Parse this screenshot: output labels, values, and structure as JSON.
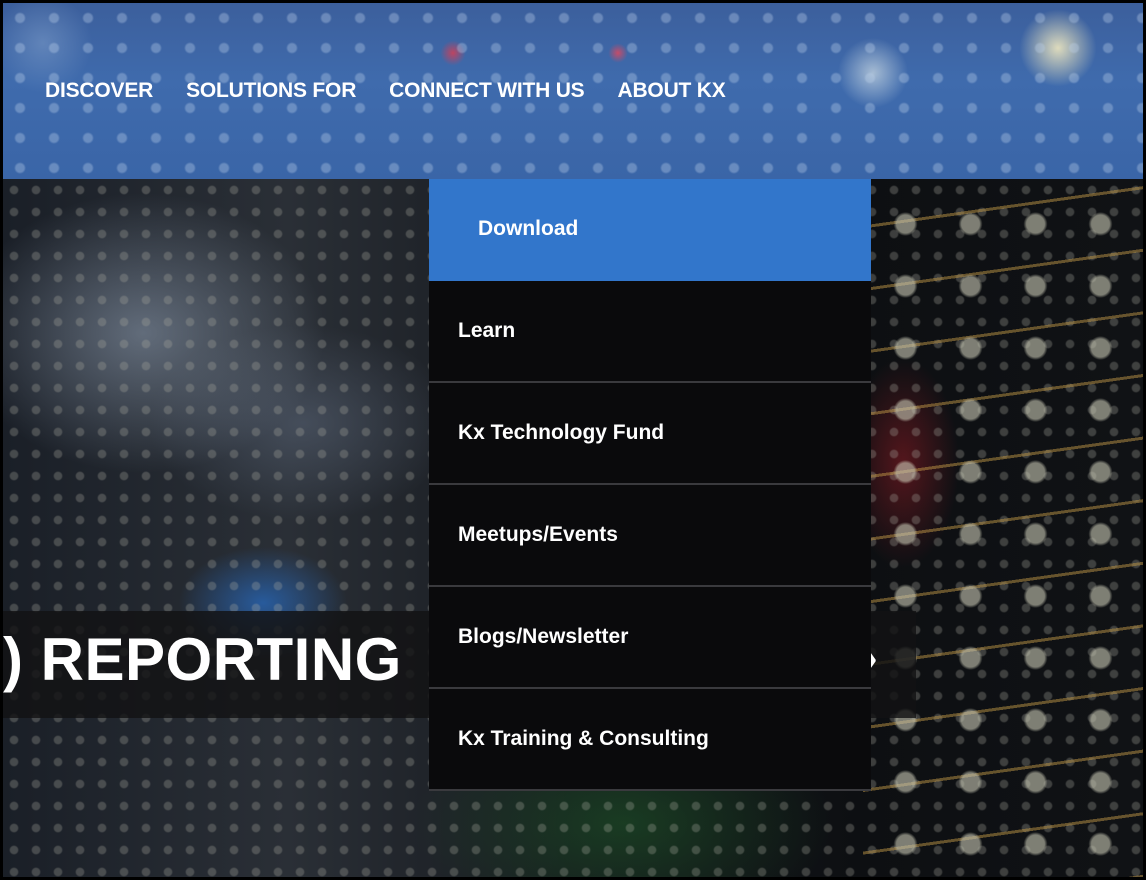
{
  "nav": {
    "items": [
      {
        "label": "DISCOVER"
      },
      {
        "label": "SOLUTIONS FOR"
      },
      {
        "label": "CONNECT WITH US"
      },
      {
        "label": "ABOUT KX"
      }
    ]
  },
  "dropdown": {
    "items": [
      {
        "label": "Download",
        "active": true
      },
      {
        "label": "Learn"
      },
      {
        "label": "Kx Technology Fund"
      },
      {
        "label": "Meetups/Events"
      },
      {
        "label": "Blogs/Newsletter"
      },
      {
        "label": "Kx Training & Consulting"
      }
    ],
    "active_color": "#3276cb",
    "background_color": "#0a0a0c"
  },
  "hero": {
    "text": ") REPORTING",
    "arrow_icon": "chevron-right-icon",
    "arrow_glyph": "›"
  },
  "colors": {
    "header_blue": "#3f6bad"
  }
}
